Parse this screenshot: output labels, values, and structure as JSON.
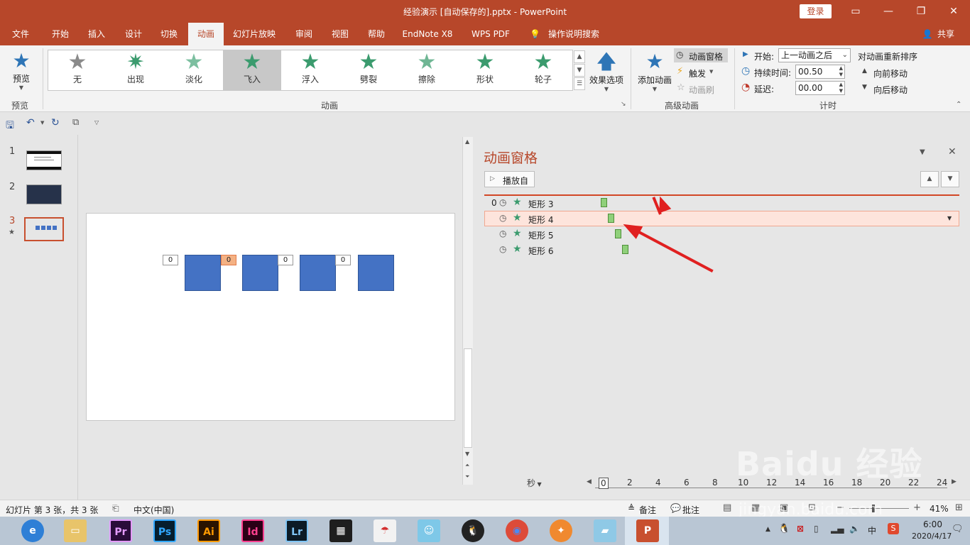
{
  "titlebar": {
    "title": "经验演示 [自动保存的].pptx - PowerPoint",
    "login_label": "登录",
    "share_label": "共享"
  },
  "tabs": [
    {
      "label": "文件"
    },
    {
      "label": "开始"
    },
    {
      "label": "插入"
    },
    {
      "label": "设计"
    },
    {
      "label": "切换"
    },
    {
      "label": "动画"
    },
    {
      "label": "幻灯片放映"
    },
    {
      "label": "审阅"
    },
    {
      "label": "视图"
    },
    {
      "label": "帮助"
    },
    {
      "label": "EndNote X8"
    },
    {
      "label": "WPS PDF"
    },
    {
      "label": "操作说明搜索"
    }
  ],
  "ribbon": {
    "preview": {
      "label": "预览",
      "group": "预览"
    },
    "gallery": {
      "group": "动画",
      "items": [
        {
          "label": "无"
        },
        {
          "label": "出现"
        },
        {
          "label": "淡化"
        },
        {
          "label": "飞入"
        },
        {
          "label": "浮入"
        },
        {
          "label": "劈裂"
        },
        {
          "label": "擦除"
        },
        {
          "label": "形状"
        },
        {
          "label": "轮子"
        }
      ],
      "selected": "飞入"
    },
    "effect_options": "效果选项",
    "advanced": {
      "group": "高级动画",
      "add_animation": "添加动画",
      "animation_pane": "动画窗格",
      "trigger": "触发",
      "painter": "动画刷"
    },
    "timing": {
      "group": "计时",
      "start_label": "开始:",
      "start_value": "上一动画之后",
      "duration_label": "持续时间:",
      "duration_value": "00.50",
      "delay_label": "延迟:",
      "delay_value": "00.00",
      "reorder_title": "对动画重新排序",
      "move_earlier": "向前移动",
      "move_later": "向后移动"
    }
  },
  "slides": [
    {
      "number": "1"
    },
    {
      "number": "2"
    },
    {
      "number": "3",
      "active": true
    }
  ],
  "slide_tags": [
    "0",
    "0",
    "0",
    "0"
  ],
  "pane": {
    "title": "动画窗格",
    "play_from": "播放自",
    "rows": [
      {
        "index": "0",
        "name": "矩形 3"
      },
      {
        "index": "",
        "name": "矩形 4",
        "selected": true
      },
      {
        "index": "",
        "name": "矩形 5"
      },
      {
        "index": "",
        "name": "矩形 6"
      }
    ],
    "timeline_unit": "秒",
    "ticks": [
      "0",
      "2",
      "4",
      "6",
      "8",
      "10",
      "12",
      "14",
      "16",
      "18",
      "20",
      "22",
      "24"
    ]
  },
  "status": {
    "slide_info": "幻灯片 第 3 张，共 3 张",
    "language": "中文(中国)",
    "notes": "备注",
    "comments": "批注",
    "zoom": "41%"
  },
  "taskbar": {
    "apps": [
      "Pr",
      "Ps",
      "Ai",
      "Id",
      "Lr"
    ],
    "ime": "中",
    "time": "6:00",
    "date": "2020/4/17"
  },
  "watermark": {
    "text": "jingyan.baidu.com"
  },
  "colors": {
    "accent": "#b7472a",
    "shape": "#4472c4",
    "gantt": "#8fd07a",
    "arrow": "#e02020"
  }
}
